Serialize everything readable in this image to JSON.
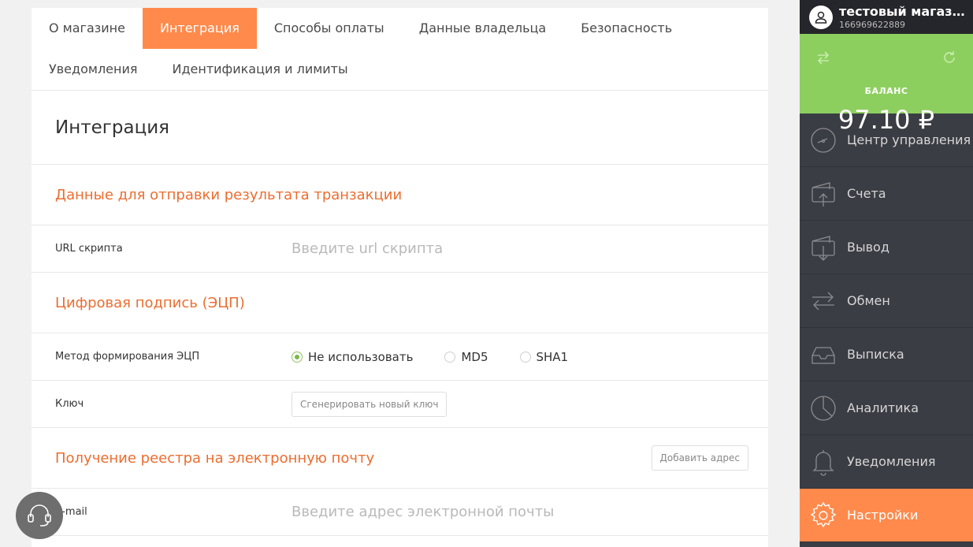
{
  "tabs": [
    {
      "label": "О магазине"
    },
    {
      "label": "Интеграция"
    },
    {
      "label": "Способы оплаты"
    },
    {
      "label": "Данные владельца"
    },
    {
      "label": "Безопасность"
    },
    {
      "label": "Уведомления"
    },
    {
      "label": "Идентификация и лимиты"
    }
  ],
  "active_tab": "Интеграция",
  "page_title": "Интеграция",
  "sections": {
    "transaction": {
      "title": "Данные для отправки результата транзакции",
      "url_label": "URL скрипта",
      "url_placeholder": "Введите url скрипта"
    },
    "signature": {
      "title": "Цифровая подпись (ЭЦП)",
      "method_label": "Метод формирования ЭЦП",
      "options": [
        "Не использовать",
        "MD5",
        "SHA1"
      ],
      "selected": "Не использовать",
      "key_label": "Ключ",
      "generate_button": "Сгенерировать новый ключ"
    },
    "registry": {
      "title": "Получение реестра на электронную почту",
      "add_button": "Добавить адрес",
      "email_label": "E-mail",
      "email_placeholder": "Введите адрес электронной почты"
    }
  },
  "sidebar": {
    "shop_name": "тестовый магазин",
    "shop_id": "166969622889",
    "balance_label": "БАЛАНС",
    "balance_amount": "97.10 ₽",
    "menu": [
      {
        "label": "Центр управления",
        "icon": "speedometer-icon"
      },
      {
        "label": "Счета",
        "icon": "invoice-icon"
      },
      {
        "label": "Вывод",
        "icon": "withdraw-icon"
      },
      {
        "label": "Обмен",
        "icon": "exchange-icon"
      },
      {
        "label": "Выписка",
        "icon": "statement-icon"
      },
      {
        "label": "Аналитика",
        "icon": "pie-chart-icon"
      },
      {
        "label": "Уведомления",
        "icon": "bell-icon"
      },
      {
        "label": "Настройки",
        "icon": "gear-icon"
      }
    ],
    "active_menu": "Настройки"
  },
  "colors": {
    "accent": "#ff8a4c",
    "section_title": "#ec6d2f",
    "balance_bg": "#8dcf5f",
    "sidebar_bg": "#3b3d44"
  }
}
